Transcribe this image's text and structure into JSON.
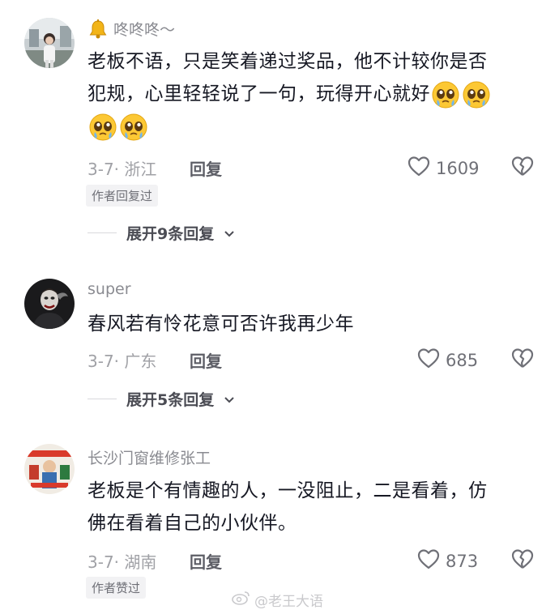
{
  "comments": [
    {
      "username": "咚咚咚～",
      "text_line1": "老板不语，只是笑着递过奖品，他不计较你是否",
      "text_line2": "犯规，心里轻轻说了一句，玩得开心就好",
      "date_location": "3-7· 浙江",
      "reply_label": "回复",
      "likes": "1609",
      "badge": "作者回复过",
      "expand_label": "展开9条回复"
    },
    {
      "username": "super",
      "text_line1": "春风若有怜花意可否许我再少年",
      "date_location": "3-7· 广东",
      "reply_label": "回复",
      "likes": "685",
      "expand_label": "展开5条回复"
    },
    {
      "username": "长沙门窗维修张工",
      "text_line1": "老板是个有情趣的人，一没阻止，二是看着，仿",
      "text_line2": "佛在看着自己的小伙伴。",
      "date_location": "3-7· 湖南",
      "reply_label": "回复",
      "likes": "873",
      "badge": "作者赞过"
    }
  ],
  "watermark": "@老王大语",
  "icons": {
    "bell": "bell-icon",
    "like": "heart-outline-icon",
    "dislike": "broken-heart-icon",
    "expand": "chevron-down-icon",
    "emoji": "pleading-face-emoji"
  }
}
